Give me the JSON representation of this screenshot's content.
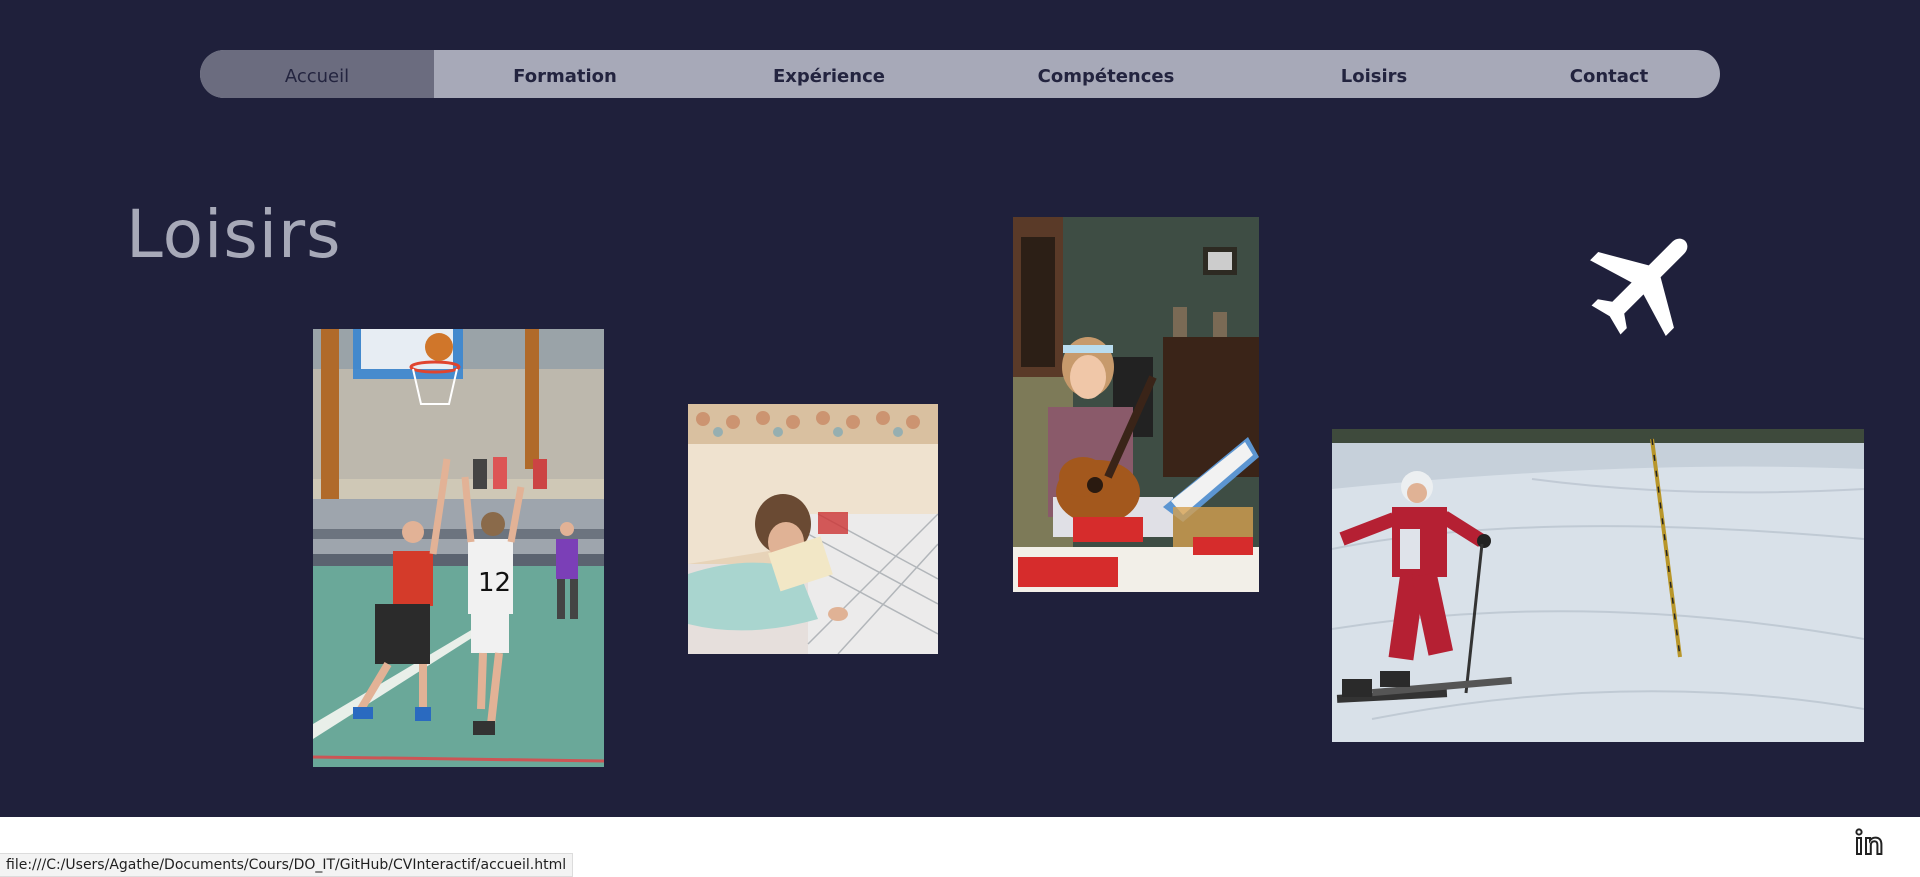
{
  "nav": {
    "items": [
      {
        "label": "Accueil",
        "active": true
      },
      {
        "label": "Formation",
        "active": false
      },
      {
        "label": "Expérience",
        "active": false
      },
      {
        "label": "Compétences",
        "active": false
      },
      {
        "label": "Loisirs",
        "active": false
      },
      {
        "label": "Contact",
        "active": false
      }
    ]
  },
  "page": {
    "title": "Loisirs"
  },
  "photos": [
    {
      "subject": "basketball"
    },
    {
      "subject": "reading"
    },
    {
      "subject": "guitar"
    },
    {
      "subject": "skiing"
    }
  ],
  "icons": {
    "travel": "airplane-icon",
    "social": "linkedin-icon"
  },
  "status": {
    "url": "file:///C:/Users/Agathe/Documents/Cours/DO_IT/GitHub/CVInteractif/accueil.html"
  },
  "colors": {
    "background": "#1f203b",
    "nav_bg": "#a7a9b8",
    "nav_active": "#6b6c7f",
    "title": "#a7a9b8"
  }
}
